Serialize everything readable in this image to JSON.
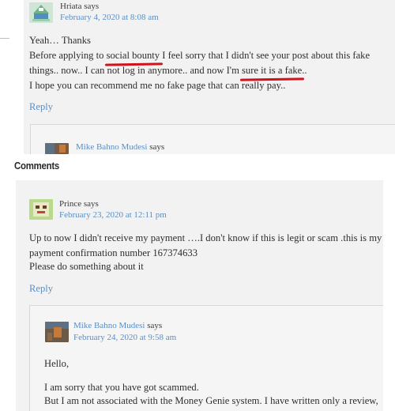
{
  "colors": {
    "link": "#5a8fc4",
    "underline_mark": "#d0121b",
    "panel_bg": "#f2f2f2"
  },
  "top_comment": {
    "author": "Hriata says",
    "date": "February 4, 2020 at 8:08 am",
    "lines": {
      "l1": "Yeah… Thanks",
      "l2_pre": "Before applying to ",
      "l2_mark": "social bounty",
      "l2_post": " I feel sorry that I didn't see your post about this fake",
      "l3_pre": "things.. now.. I can not log in anymore.. and now I'm ",
      "l3_mark": "sure it is a fake",
      "l3_post": "..",
      "l4": "I hope you can recommend me no fake page that can really pay.."
    },
    "reply": "Reply",
    "nested_author": "Mike Bahno Mudesi",
    "nested_says": "says"
  },
  "section_heading": "Comments",
  "bottom_comment": {
    "author": "Prince says",
    "date": "February 23, 2020 at 12:11 pm",
    "lines": {
      "l1": "Up to now I didn't receive my payment ….I don't know if this is legit or scam .this is my",
      "l2": "payment confirmation number 167374633",
      "l3": "Please do something about it"
    },
    "reply": "Reply",
    "nested": {
      "author": "Mike Bahno Mudesi",
      "says": "says",
      "date": "February 24, 2020 at 9:58 am",
      "l1": "Hello,",
      "l2": "I am sorry that you have got scammed.",
      "l3": "But I am not associated with the Money Genie system. I have written only a review,"
    }
  }
}
